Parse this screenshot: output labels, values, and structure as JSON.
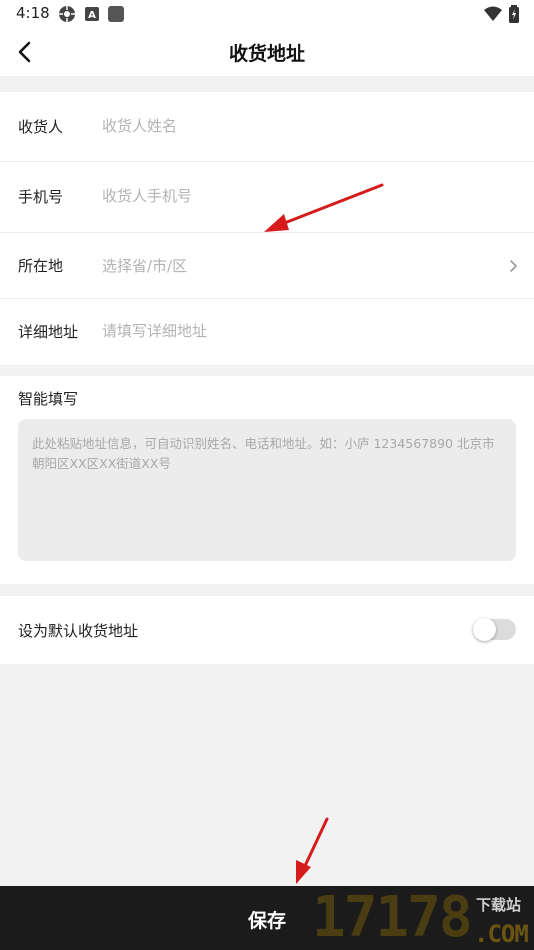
{
  "status_bar": {
    "time": "4:18",
    "left_icons": [
      "settings-gear-icon",
      "app-a-icon",
      "square-icon"
    ],
    "right_icons": [
      "wifi-icon",
      "battery-icon"
    ]
  },
  "header": {
    "title": "收货地址",
    "back_icon": "chevron-left-icon"
  },
  "form": {
    "rows": [
      {
        "label": "收货人",
        "placeholder": "收货人姓名",
        "value": ""
      },
      {
        "label": "手机号",
        "placeholder": "收货人手机号",
        "value": ""
      },
      {
        "label": "所在地",
        "placeholder": "选择省/市/区",
        "value": ""
      },
      {
        "label": "详细地址",
        "placeholder": "请填写详细地址",
        "value": ""
      }
    ]
  },
  "smart_fill": {
    "title": "智能填写",
    "placeholder": "此处粘贴地址信息，可自动识别姓名、电话和地址。如：小庐 1234567890 北京市朝阳区XX区XX街道XX号",
    "value": ""
  },
  "default_address": {
    "label": "设为默认收货地址",
    "enabled": false
  },
  "footer": {
    "save_label": "保存"
  },
  "watermark": {
    "digits": "17178",
    "text": "下载站",
    "suffix": ".COM"
  },
  "colors": {
    "background": "#f2f2f2",
    "card": "#ffffff",
    "save_bar": "#1b1b1b",
    "placeholder": "#b3b3b3",
    "annotation_arrow": "#d61b1b"
  }
}
